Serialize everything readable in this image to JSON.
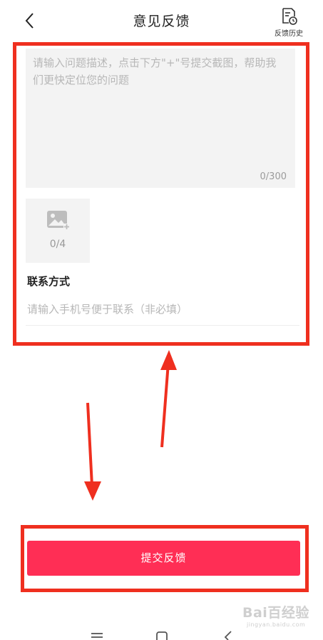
{
  "header": {
    "title": "意见反馈",
    "back_icon": "chevron-left-icon",
    "history_label": "反馈历史",
    "history_icon": "document-clock-icon"
  },
  "feedback": {
    "placeholder": "请输入问题描述，点击下方\"+\"号提交截图，帮助我们更快定位您的问题",
    "counter": "0/300"
  },
  "image_upload": {
    "icon": "add-image-icon",
    "count": "0/4"
  },
  "contact": {
    "title": "联系方式",
    "placeholder": "请输入手机号便于联系（非必填）"
  },
  "submit": {
    "label": "提交反馈",
    "color": "#ff2e55"
  },
  "annotation": {
    "highlight_color": "#ef2f1f"
  },
  "watermark": {
    "brand": "Bai百经验",
    "url": "jingyan.baidu.com"
  }
}
